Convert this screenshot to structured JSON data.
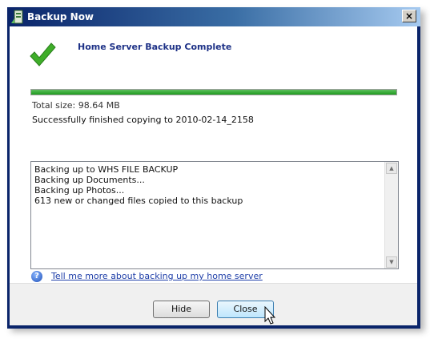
{
  "window": {
    "title": "Backup Now",
    "close_glyph": "×",
    "app_icon": "home-server-icon"
  },
  "main": {
    "status_icon": "checkmark-icon",
    "heading": "Home Server Backup Complete",
    "progress_percent": 100,
    "total_size": "Total size: 98.64 MB",
    "finished_message": "Successfully finished copying to 2010-02-14_2158"
  },
  "log": {
    "lines": [
      "Backing up  to  WHS FILE BACKUP",
      "Backing up Documents...",
      "Backing up Photos...",
      "613 new or changed files copied to this backup"
    ]
  },
  "help": {
    "icon": "question-icon",
    "glyph": "?",
    "link_text": "Tell me more about backing up my home server"
  },
  "buttons": {
    "hide_label": "Hide",
    "close_label": "Close"
  },
  "colors": {
    "accent": "#0a246a",
    "progress": "#1f9a1f",
    "check": "#3fae29",
    "heading": "#1e3287"
  }
}
